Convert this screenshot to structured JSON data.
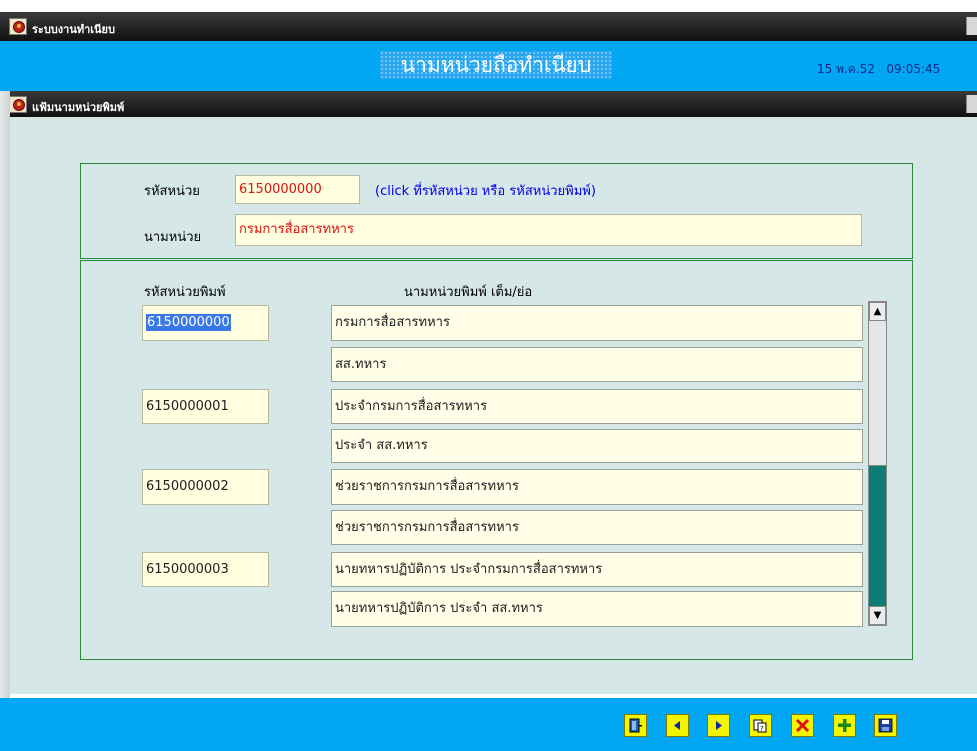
{
  "window": {
    "title": "ระบบงานทำเนียบ"
  },
  "header": {
    "title": "นามหน่วยถือทำเนียบ",
    "date": "15 พ.ค.52",
    "time": "09:05:45"
  },
  "subwindow": {
    "title": "แฟ้มนามหน่วยพิมพ์"
  },
  "unit": {
    "code_label": "รหัสหน่วย",
    "code_value": "6150000000",
    "hint": "(click ที่รหัสหน่วย หรือ รหัสหน่วยพิมพ์)",
    "name_label": "นามหน่วย",
    "name_value": "กรมการสื่อสารทหาร"
  },
  "print_table": {
    "col_code": "รหัสหน่วยพิมพ์",
    "col_name": "นามหน่วยพิมพ์ เต็ม/ย่อ",
    "rows": [
      {
        "code": "6150000000",
        "full": "กรมการสื่อสารทหาร",
        "short": "สส.ทหาร"
      },
      {
        "code": "6150000001",
        "full": "ประจำกรมการสื่อสารทหาร",
        "short": "ประจำ สส.ทหาร"
      },
      {
        "code": "6150000002",
        "full": "ช่วยราชการกรมการสื่อสารทหาร",
        "short": "ช่วยราชการกรมการสื่อสารทหาร"
      },
      {
        "code": "6150000003",
        "full": "นายทหารปฏิบัติการ ประจำกรมการสื่อสารทหาร",
        "short": "นายทหารปฏิบัติการ ประจำ สส.ทหาร"
      }
    ]
  },
  "toolbar": {
    "icons": [
      "exit-door-icon",
      "previous-icon",
      "next-icon",
      "search-icon",
      "delete-icon",
      "add-icon",
      "save-icon"
    ]
  },
  "colors": {
    "header_bg": "#02a7f4",
    "form_bg": "#d6e7e7",
    "field_bg": "#ffffe0",
    "toolbar_button": "#f4f400"
  }
}
